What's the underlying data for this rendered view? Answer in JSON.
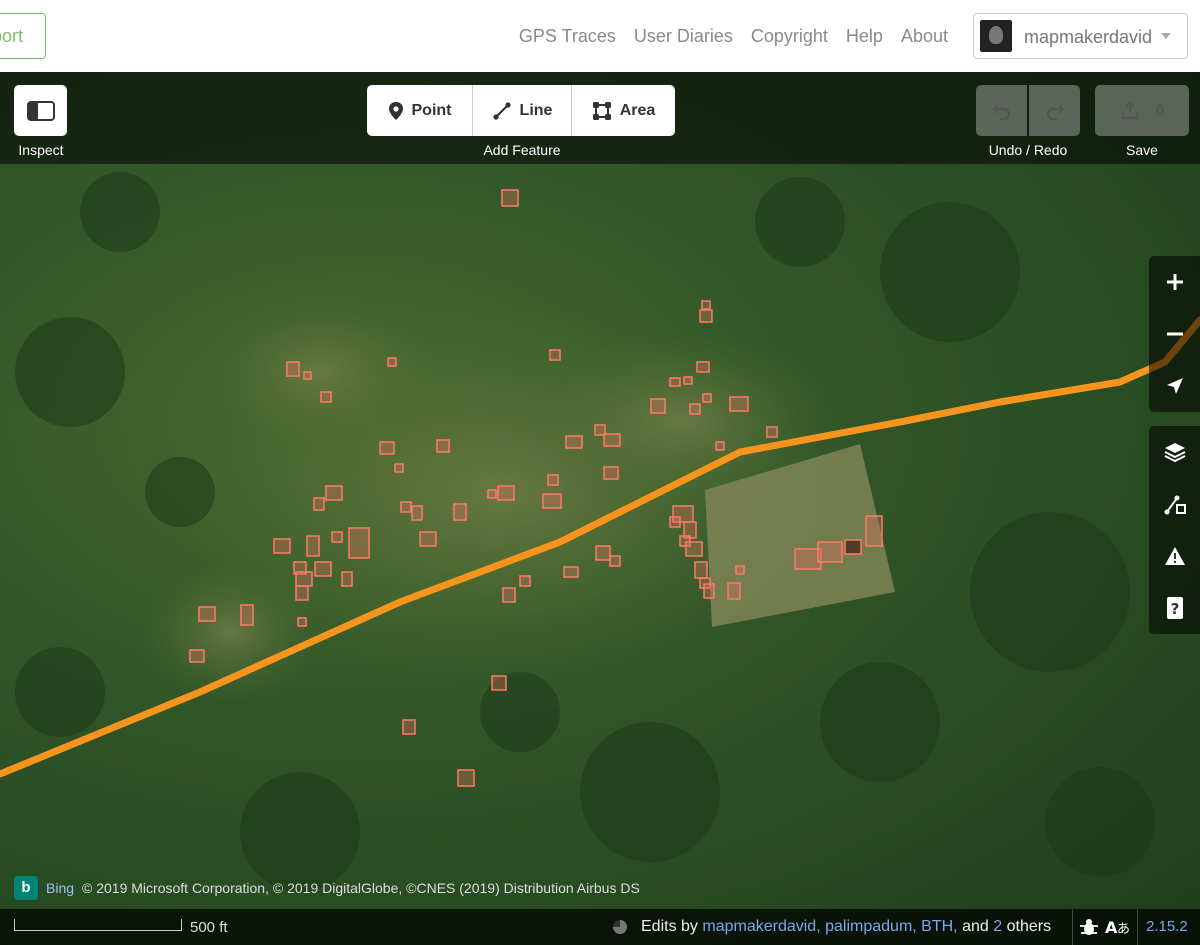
{
  "top_nav": {
    "export_label": "Export",
    "links": [
      "GPS Traces",
      "User Diaries",
      "Copyright",
      "Help",
      "About"
    ],
    "username": "mapmakerdavid"
  },
  "toolbar": {
    "inspect_label": "Inspect",
    "add_feature_label": "Add Feature",
    "point_label": "Point",
    "line_label": "Line",
    "area_label": "Area",
    "undo_redo_label": "Undo / Redo",
    "save_label": "Save",
    "save_count": "0"
  },
  "right_controls": {
    "zoom_in_icon": "plus-icon",
    "zoom_out_icon": "minus-icon",
    "geolocate_icon": "location-arrow-icon",
    "background_icon": "layers-icon",
    "map_data_icon": "map-data-icon",
    "issues_icon": "warning-icon",
    "help_icon": "help-icon"
  },
  "attribution": {
    "provider": "Bing",
    "text": "© 2019 Microsoft Corporation, © 2019 DigitalGlobe, ©CNES (2019) Distribution Airbus DS"
  },
  "footer": {
    "scale": "500 ft",
    "edits_prefix": "Edits by",
    "users": [
      "mapmakerdavid,",
      "palimpadum,",
      "BTH,"
    ],
    "and": "and",
    "others_count": "2",
    "others": "others",
    "version": "2.15.2"
  },
  "colors": {
    "road": "#f7941d",
    "building": "#e06e5f",
    "accent_green": "#7ebc6f",
    "link_blue": "#7aa7f0"
  }
}
